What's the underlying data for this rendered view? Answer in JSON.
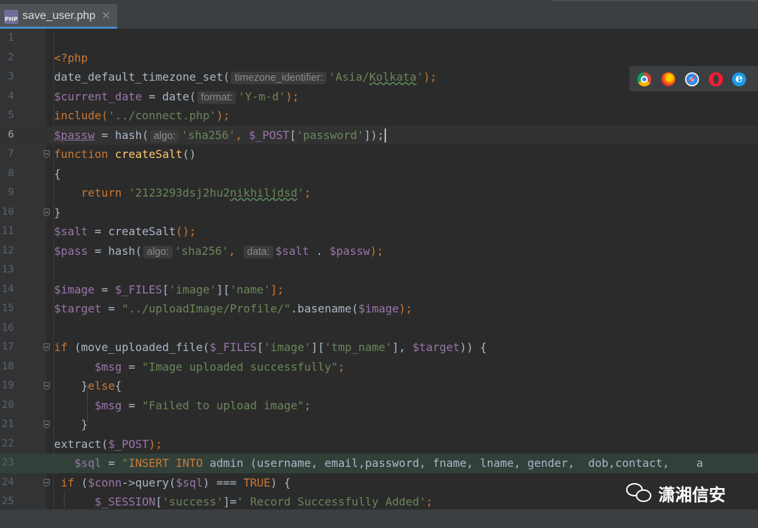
{
  "tab": {
    "icon_text": "PHP",
    "label": "save_user.php",
    "close": "×"
  },
  "browser_icons": {
    "chrome": "chrome-icon",
    "firefox": "firefox-icon",
    "safari": "safari-icon",
    "opera": "opera-icon",
    "ie": "ie-icon",
    "ie_glyph": "e"
  },
  "watermark": {
    "text": "潇湘信安"
  },
  "line_numbers": [
    "1",
    "2",
    "3",
    "4",
    "5",
    "6",
    "7",
    "8",
    "9",
    "10",
    "11",
    "12",
    "13",
    "14",
    "15",
    "16",
    "17",
    "18",
    "19",
    "20",
    "21",
    "22",
    "23",
    "24",
    "25"
  ],
  "code": {
    "l2": {
      "open": "<?php"
    },
    "l3": {
      "fn": "date_default_timezone_set(",
      "hint": "timezone_identifier:",
      "q1": "'Asia/",
      "tz": "Kolkata",
      "q2": "'",
      "end": ");"
    },
    "l4": {
      "var": "$current_date",
      "eq": " = date(",
      "hint": "format:",
      "str": "'Y-m-d'",
      "end": ");"
    },
    "l5": {
      "fn": "include(",
      "str": "'../connect.php'",
      "end": ");"
    },
    "l6": {
      "var": "$passw",
      "eq": " = hash(",
      "hint": "algo:",
      "str": "'sha256'",
      "comma": ", ",
      "post": "$_POST",
      "br1": "[",
      "key": "'password'",
      "end": "]);"
    },
    "l7": {
      "kw": "function ",
      "name": "createSalt",
      "end": "()"
    },
    "l8": {
      "brace": "{"
    },
    "l9": {
      "indent": "    ",
      "kw": "return ",
      "q1": "'2123293dsj2hu2",
      "salt": "nikhiljdsd",
      "q2": "'",
      "end": ";"
    },
    "l10": {
      "brace": "}"
    },
    "l11": {
      "var": "$salt",
      "eq": " = createSalt",
      "end": "();"
    },
    "l12": {
      "var": "$pass",
      "eq": " = hash(",
      "hint": "algo:",
      "str": "'sha256'",
      "comma": ", ",
      "hint2": "data:",
      "v1": "$salt",
      "dot": " . ",
      "v2": "$passw",
      "end": ");"
    },
    "l14": {
      "var": "$image",
      "eq": " = ",
      "files": "$_FILES",
      "b1": "[",
      "k1": "'image'",
      "b2": "][",
      "k2": "'name'",
      "end": "];"
    },
    "l15": {
      "var": "$target",
      "eq": " = ",
      "str": "\"../uploadImage/Profile/\"",
      "fn": ".basename(",
      "v": "$image",
      "end": ");"
    },
    "l17": {
      "kw": "if ",
      "fn": "(move_uploaded_file(",
      "files": "$_FILES",
      "b1": "[",
      "k1": "'image'",
      "b2": "][",
      "k2": "'tmp_name'",
      "b3": "], ",
      "v": "$target",
      "end": ")) {"
    },
    "l18": {
      "indent": "      ",
      "var": "$msg",
      "eq": " = ",
      "str": "\"Image uploaded successfully\"",
      "end": ";"
    },
    "l19": {
      "indent": "    ",
      "b": "}",
      "kw": "else",
      "end": "{"
    },
    "l20": {
      "indent": "      ",
      "var": "$msg",
      "eq": " = ",
      "str": "\"Failed to upload image\"",
      "end": ";"
    },
    "l21": {
      "indent": "    ",
      "b": "}"
    },
    "l22": {
      "fn": "extract(",
      "v": "$_POST",
      "end": ");"
    },
    "l23": {
      "indent": "   ",
      "var": "$sql",
      "eq": " = ",
      "q": "\"",
      "sql1": "INSERT INTO",
      "sql2": " admin (username, email,password, fname, lname, gender,  dob,contact,    a"
    },
    "l24": {
      "indent": " ",
      "kw": "if ",
      "p": "(",
      "v": "$conn",
      "arrow": "->",
      "fn": "query",
      "p2": "(",
      "v2": "$sql",
      "op": ") === ",
      "kw2": "TRUE",
      "end": ") {"
    },
    "l25": {
      "indent": "      ",
      "v": "$_SESSION",
      "b1": "[",
      "k": "'success'",
      "b2": "]=",
      "str": "' Record Successfully Added'",
      "end": ";"
    }
  },
  "colors": {
    "background": "#2b2b2b",
    "gutter": "#313335",
    "keyword": "#cc7832",
    "string": "#6a8759",
    "variable": "#9876aa",
    "function": "#ffc66d",
    "text": "#a9b7c6",
    "tab_accent": "#4a88c7"
  }
}
